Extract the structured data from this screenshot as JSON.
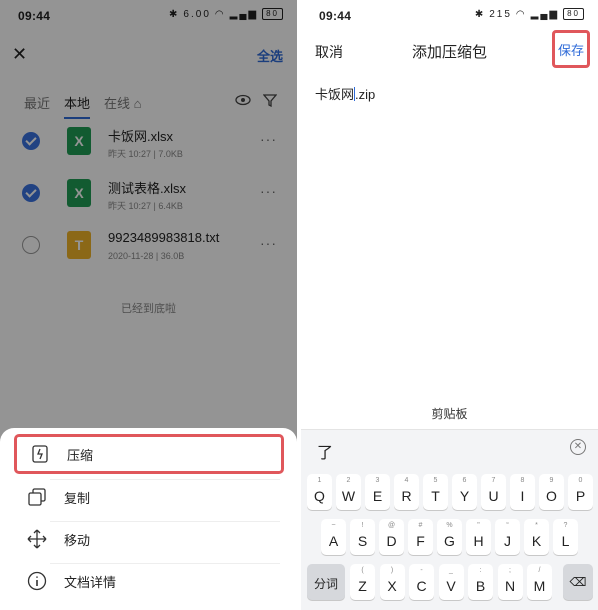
{
  "status_left": {
    "time": "09:44",
    "speed": "6.00",
    "battery": "80"
  },
  "status_right": {
    "time": "09:44",
    "speed": "215",
    "battery": "80"
  },
  "left": {
    "select_all": "全选",
    "tabs": [
      "最近",
      "本地",
      "在线"
    ],
    "files": [
      {
        "name": "卡饭网.xlsx",
        "meta": "昨天 10:27  |  7.0KB",
        "icon": "X",
        "checked": true
      },
      {
        "name": "测试表格.xlsx",
        "meta": "昨天 10:27  |  6.4KB",
        "icon": "X",
        "checked": true
      },
      {
        "name": "9923489983818.txt",
        "meta": "2020-11-28  |  36.0B",
        "icon": "T",
        "checked": false
      }
    ],
    "end_text": "已经到底啦",
    "actions": [
      {
        "label": "压缩",
        "icon": "compress-icon"
      },
      {
        "label": "复制",
        "icon": "copy-icon"
      },
      {
        "label": "移动",
        "icon": "move-icon"
      },
      {
        "label": "文档详情",
        "icon": "info-icon"
      }
    ]
  },
  "right": {
    "cancel": "取消",
    "title": "添加压缩包",
    "save": "保存",
    "filename_before": "卡饭网",
    "filename_after": ".zip",
    "clipboard": "剪贴板",
    "candidate": "了",
    "keyboard": {
      "row1": [
        {
          "main": "Q",
          "sub": "1"
        },
        {
          "main": "W",
          "sub": "2"
        },
        {
          "main": "E",
          "sub": "3"
        },
        {
          "main": "R",
          "sub": "4"
        },
        {
          "main": "T",
          "sub": "5"
        },
        {
          "main": "Y",
          "sub": "6"
        },
        {
          "main": "U",
          "sub": "7"
        },
        {
          "main": "I",
          "sub": "8"
        },
        {
          "main": "O",
          "sub": "9"
        },
        {
          "main": "P",
          "sub": "0"
        }
      ],
      "row2": [
        {
          "main": "A",
          "sub": "~"
        },
        {
          "main": "S",
          "sub": "!"
        },
        {
          "main": "D",
          "sub": "@"
        },
        {
          "main": "F",
          "sub": "#"
        },
        {
          "main": "G",
          "sub": "%"
        },
        {
          "main": "H",
          "sub": "\""
        },
        {
          "main": "J",
          "sub": "“"
        },
        {
          "main": "K",
          "sub": "*"
        },
        {
          "main": "L",
          "sub": "?"
        }
      ],
      "row3": [
        {
          "main": "Z",
          "sub": "("
        },
        {
          "main": "X",
          "sub": ")"
        },
        {
          "main": "C",
          "sub": "-"
        },
        {
          "main": "V",
          "sub": "_"
        },
        {
          "main": "B",
          "sub": ":"
        },
        {
          "main": "N",
          "sub": ";"
        },
        {
          "main": "M",
          "sub": "/"
        }
      ],
      "fenci": "分词",
      "backspace": "⌫"
    }
  },
  "colors": {
    "accent": "#2f6bd8",
    "highlight": "#e0575b",
    "excel": "#1f9d55",
    "text_file": "#f0b429"
  }
}
